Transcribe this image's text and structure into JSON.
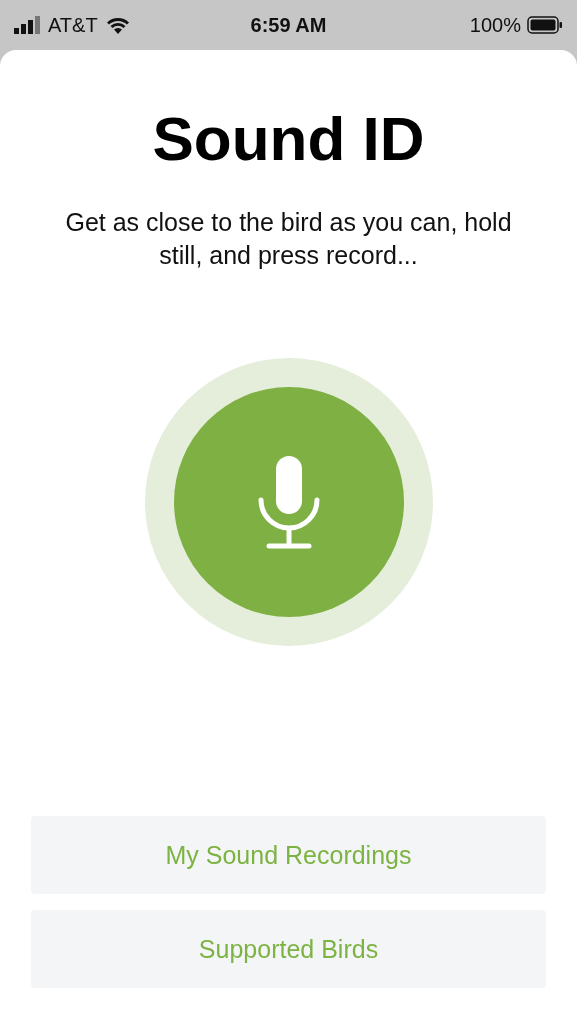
{
  "status_bar": {
    "carrier": "AT&T",
    "time": "6:59 AM",
    "battery": "100%"
  },
  "title": "Sound ID",
  "instructions": "Get as close to the bird as you can, hold still, and press record...",
  "record_button": {
    "recording": false
  },
  "buttons": [
    {
      "label": "My Sound Recordings"
    },
    {
      "label": "Supported Birds"
    }
  ]
}
